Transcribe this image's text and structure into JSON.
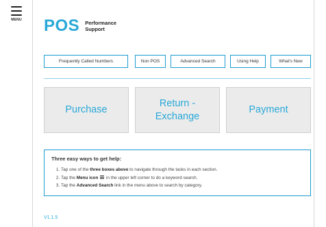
{
  "menu": {
    "label": "MENU",
    "icon": "hamburger-icon"
  },
  "logo": {
    "main": "POS",
    "sub_line1": "Performance",
    "sub_line2": "Support",
    "color": "#29a8d8"
  },
  "nav": {
    "items": [
      {
        "label": "Frequently Called Numbers"
      },
      {
        "label": "Non POS"
      },
      {
        "label": "Advanced Search"
      },
      {
        "label": "Using Help"
      },
      {
        "label": "What's New"
      }
    ]
  },
  "tiles": [
    {
      "line1": "Purchase",
      "line2": ""
    },
    {
      "line1": "Return -",
      "line2": "Exchange"
    },
    {
      "line1": "Payment",
      "line2": ""
    }
  ],
  "help": {
    "title": "Three easy ways to get help:",
    "items": [
      {
        "pre": "Tap one of the ",
        "bold": "three boxes above",
        "post": " to navigate through the tasks in each section."
      },
      {
        "pre": "Tap the ",
        "bold": "Menu icon",
        "post": " in the upper left corner to do a keyword search."
      },
      {
        "pre": "Tap the ",
        "bold": "Advanced Search",
        "post": " link in the menu above to search by category."
      }
    ]
  },
  "version": "V1.1.5",
  "colors": {
    "accent": "#29a8d8",
    "border": "#1d9bd0",
    "tile_bg": "#ebebeb"
  }
}
